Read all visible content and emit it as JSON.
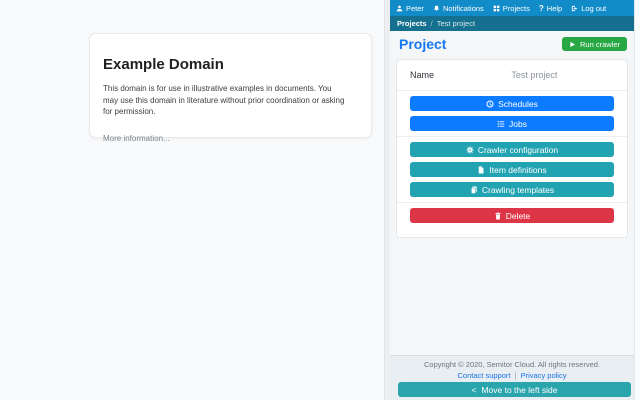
{
  "colors": {
    "topbar": "#128bc9",
    "breadcrumb_bar": "#15708f",
    "title_blue": "#1778f2",
    "primary_button": "#0d7bff",
    "info_button": "#22a3b1",
    "danger_button": "#dc3545",
    "success_button": "#28a745",
    "move_bar": "#2ba5ac",
    "link_blue": "#1a73e8"
  },
  "left_page": {
    "heading": "Example Domain",
    "body": "This domain is for use in illustrative examples in documents. You may use this domain in literature without prior coordination or asking for permission.",
    "link": "More information..."
  },
  "panel": {
    "nav": {
      "user": "Peter",
      "notifications": "Notifications",
      "projects": "Projects",
      "help": "Help",
      "help_icon": "?",
      "logout": "Log out"
    },
    "breadcrumb": {
      "root": "Projects",
      "separator": "/",
      "current": "Test project"
    },
    "header": {
      "title": "Project",
      "run_button": "Run crawler"
    },
    "card": {
      "name_label": "Name",
      "name_value": "Test project",
      "actions": [
        {
          "label": "Schedules",
          "icon": "clock-icon",
          "style": "primary"
        },
        {
          "label": "Jobs",
          "icon": "list-icon",
          "style": "primary"
        },
        {
          "label": "Crawler configuration",
          "icon": "gear-icon",
          "style": "info"
        },
        {
          "label": "Item definitions",
          "icon": "file-icon",
          "style": "info"
        },
        {
          "label": "Crawling templates",
          "icon": "copy-icon",
          "style": "info"
        },
        {
          "label": "Delete",
          "icon": "trash-icon",
          "style": "danger"
        }
      ]
    },
    "footer": {
      "copyright": "Copyright © 2020, Semitor Cloud. All rights reserved.",
      "links": [
        "Contact support",
        "Privacy policy"
      ],
      "separator": "|"
    },
    "move_button": {
      "chevron": "<",
      "label": "Move to the left side"
    }
  }
}
